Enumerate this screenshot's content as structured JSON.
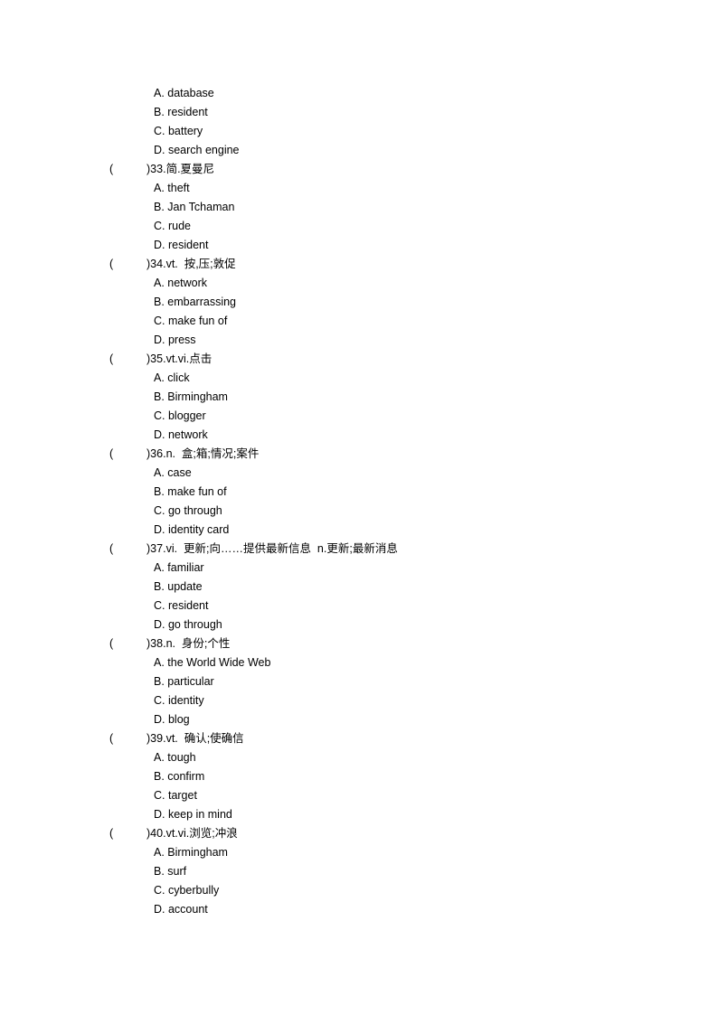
{
  "document": {
    "type": "vocabulary-multiple-choice-worksheet",
    "leading_options": [
      "A. database",
      "B. resident",
      "C. battery",
      "D. search engine"
    ],
    "questions": [
      {
        "paren_open": "(",
        "paren_close": ")",
        "number": "33.",
        "stem": "简.夏曼尼",
        "options": [
          "A. theft",
          "B. Jan Tchaman",
          "C. rude",
          "D. resident"
        ]
      },
      {
        "paren_open": "(",
        "paren_close": ")",
        "number": "34.",
        "stem": "vt.  按,压;敦促",
        "options": [
          "A. network",
          "B. embarrassing",
          "C. make fun of",
          "D. press"
        ]
      },
      {
        "paren_open": "(",
        "paren_close": ")",
        "number": "35.",
        "stem": "vt.vi.点击",
        "options": [
          "A. click",
          "B. Birmingham",
          "C. blogger",
          "D. network"
        ]
      },
      {
        "paren_open": "(",
        "paren_close": ")",
        "number": "36.",
        "stem": "n.  盒;箱;情况;案件",
        "options": [
          "A. case",
          "B. make fun of",
          "C. go through",
          "D. identity card"
        ]
      },
      {
        "paren_open": "(",
        "paren_close": ")",
        "number": "37.",
        "stem": "vi.  更新;向……提供最新信息  n.更新;最新消息",
        "options": [
          "A. familiar",
          "B. update",
          "C. resident",
          "D. go through"
        ]
      },
      {
        "paren_open": "(",
        "paren_close": ")",
        "number": "38.",
        "stem": "n.  身份;个性",
        "options": [
          "A. the World Wide Web",
          "B. particular",
          "C. identity",
          "D. blog"
        ]
      },
      {
        "paren_open": "(",
        "paren_close": ")",
        "number": "39.",
        "stem": "vt.  确认;使确信",
        "options": [
          "A. tough",
          "B. confirm",
          "C. target",
          "D. keep in mind"
        ]
      },
      {
        "paren_open": "(",
        "paren_close": ")",
        "number": "40.",
        "stem": "vt.vi.浏览;冲浪",
        "options": [
          "A. Birmingham",
          "B. surf",
          "C. cyberbully",
          "D. account"
        ]
      }
    ]
  }
}
